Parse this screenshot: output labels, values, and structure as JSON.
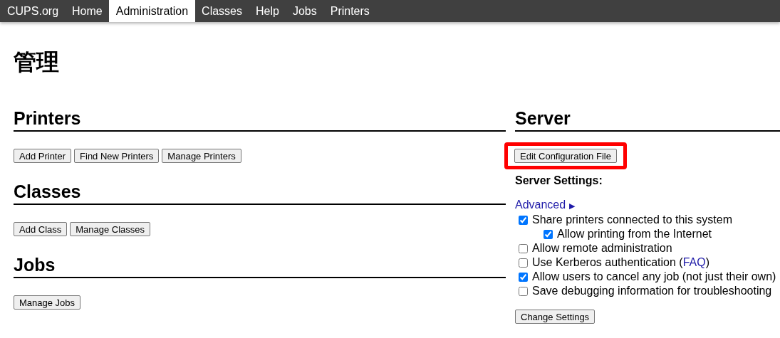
{
  "nav": [
    {
      "label": "CUPS.org",
      "selected": false
    },
    {
      "label": "Home",
      "selected": false
    },
    {
      "label": "Administration",
      "selected": true
    },
    {
      "label": "Classes",
      "selected": false
    },
    {
      "label": "Help",
      "selected": false
    },
    {
      "label": "Jobs",
      "selected": false
    },
    {
      "label": "Printers",
      "selected": false
    }
  ],
  "title": "管理",
  "sections": [
    {
      "heading": "Printers",
      "buttons": [
        "Add Printer",
        "Find New Printers",
        "Manage Printers"
      ]
    },
    {
      "heading": "Classes",
      "buttons": [
        "Add Class",
        "Manage Classes"
      ]
    },
    {
      "heading": "Jobs",
      "buttons": [
        "Manage Jobs"
      ]
    }
  ],
  "server": {
    "heading": "Server",
    "edit_button": {
      "label": "Edit Configuration File",
      "highlighted": true
    },
    "settings_label": "Server Settings:",
    "advanced": {
      "label": "Advanced",
      "marker": "▶"
    },
    "settings": [
      {
        "label": "Share printers connected to this system",
        "checked": true,
        "children": [
          {
            "label": "Allow printing from the Internet",
            "checked": true
          }
        ]
      },
      {
        "label": "Allow remote administration",
        "checked": false
      },
      {
        "label": "Use Kerberos authentication (",
        "link": "FAQ",
        "label_after": ")",
        "checked": false
      },
      {
        "label": "Allow users to cancel any job (not just their own)",
        "checked": true
      },
      {
        "label": "Save debugging information for troubleshooting",
        "checked": false
      }
    ],
    "change_button": "Change Settings"
  }
}
